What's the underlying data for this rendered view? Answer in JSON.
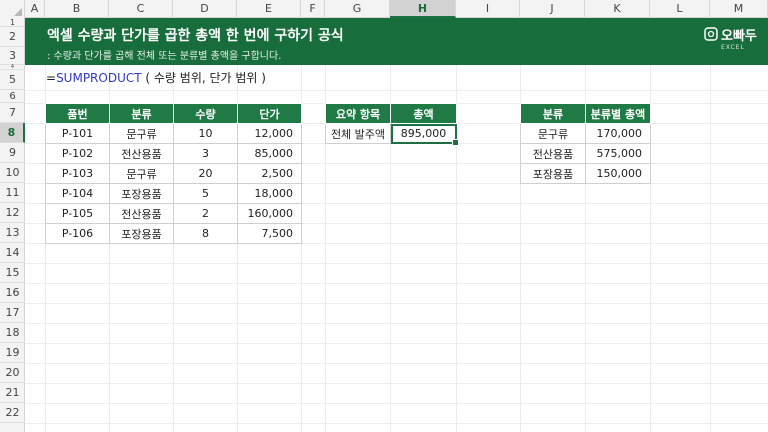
{
  "columns": [
    "A",
    "B",
    "C",
    "D",
    "E",
    "F",
    "G",
    "H",
    "I",
    "J",
    "K",
    "L",
    "M"
  ],
  "rows": [
    "1",
    "2",
    "3",
    "4",
    "5",
    "6",
    "7",
    "8",
    "9",
    "10",
    "11",
    "12",
    "13",
    "14",
    "15",
    "16",
    "17",
    "18",
    "19",
    "20",
    "21",
    "22"
  ],
  "active_cell": {
    "column": "H",
    "row": "8"
  },
  "banner": {
    "title": "엑셀 수량과 단가를 곱한 총액 한 번에 구하기 공식",
    "subtitle": ": 수량과 단가를 곱해 전체 또는 분류별 총액을 구합니다.",
    "logo_text": "오빠두",
    "logo_sub": "EXCEL",
    "background": "#176d3c"
  },
  "formula": {
    "eq": "=",
    "fn": "SUMPRODUCT",
    "args": " ( 수량 범위, 단가 범위 )"
  },
  "items_table": {
    "headers": [
      "품번",
      "분류",
      "수량",
      "단가"
    ],
    "rows": [
      [
        "P-101",
        "문구류",
        "10",
        "12,000"
      ],
      [
        "P-102",
        "전산용품",
        "3",
        "85,000"
      ],
      [
        "P-103",
        "문구류",
        "20",
        "2,500"
      ],
      [
        "P-104",
        "포장용품",
        "5",
        "18,000"
      ],
      [
        "P-105",
        "전산용품",
        "2",
        "160,000"
      ],
      [
        "P-106",
        "포장용품",
        "8",
        "7,500"
      ]
    ]
  },
  "summary_table": {
    "headers": [
      "요약 항목",
      "총액"
    ],
    "rows": [
      [
        "전체 발주액",
        "895,000"
      ]
    ]
  },
  "category_table": {
    "headers": [
      "분류",
      "분류별 총액"
    ],
    "rows": [
      [
        "문구류",
        "170,000"
      ],
      [
        "전산용품",
        "575,000"
      ],
      [
        "포장용품",
        "150,000"
      ]
    ]
  },
  "accent_color": "#1f7a45"
}
